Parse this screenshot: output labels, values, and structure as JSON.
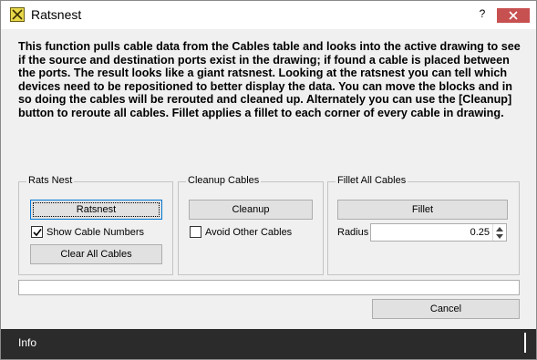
{
  "window": {
    "title": "Ratsnest",
    "help_label": "?"
  },
  "description": "This function pulls cable data from the Cables table and looks into the active drawing to see if the source and destination ports exist in the drawing; if found a cable is placed between the ports. The result looks like a giant ratsnest. Looking at the ratsnest you can tell which devices need to be repositioned to better display the data. You can move the blocks and in so doing the cables will be rerouted and cleaned up. Alternately you can use the [Cleanup] button to reroute all cables. Fillet applies a fillet to each corner of every cable in drawing.",
  "rats_nest": {
    "title": "Rats Nest",
    "ratsnest_button": "Ratsnest",
    "show_cable_numbers": {
      "label": "Show Cable Numbers",
      "checked": true
    },
    "clear_all_button": "Clear All Cables"
  },
  "cleanup": {
    "title": "Cleanup Cables",
    "cleanup_button": "Cleanup",
    "avoid_other_cables": {
      "label": "Avoid Other Cables",
      "checked": false
    }
  },
  "fillet": {
    "title": "Fillet All Cables",
    "fillet_button": "Fillet",
    "radius_label": "Radius",
    "radius_value": "0.25"
  },
  "status_text": "",
  "cancel_button": "Cancel",
  "info_bar": {
    "label": "Info"
  },
  "colors": {
    "close_button": "#c75050",
    "info_bar": "#2b2b2b",
    "focus": "#0078d7"
  }
}
